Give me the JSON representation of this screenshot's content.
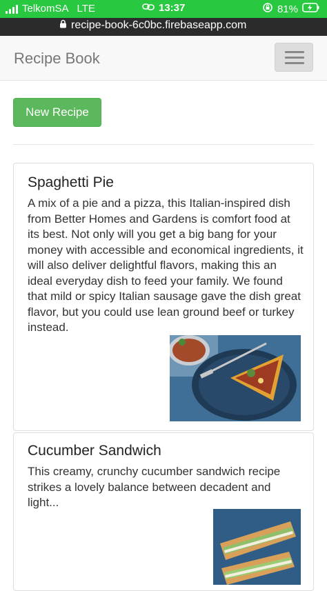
{
  "status": {
    "carrier": "TelkomSA",
    "network": "LTE",
    "time": "13:37",
    "battery": "81%"
  },
  "browser": {
    "url": "recipe-book-6c0bc.firebaseapp.com"
  },
  "navbar": {
    "brand": "Recipe Book"
  },
  "actions": {
    "new_recipe": "New Recipe"
  },
  "recipes": [
    {
      "name": "Spaghetti Pie",
      "description": "A mix of a pie and a pizza, this Italian-inspired dish from Better Homes and Gardens is comfort food at its best. Not only will you get a big bang for your money with accessible and economical ingredients, it will also deliver delightful flavors, making this an ideal everyday dish to feed your family. We found that mild or spicy Italian sausage gave the dish great flavor, but you could use lean ground beef or turkey instead."
    },
    {
      "name": "Cucumber Sandwich",
      "description": "This creamy, crunchy cucumber sandwich recipe strikes a lovely balance between decadent and light..."
    }
  ],
  "colors": {
    "status_bar": "#28c840",
    "success_button": "#5cb85c",
    "navbar_bg": "#f8f8f8"
  }
}
